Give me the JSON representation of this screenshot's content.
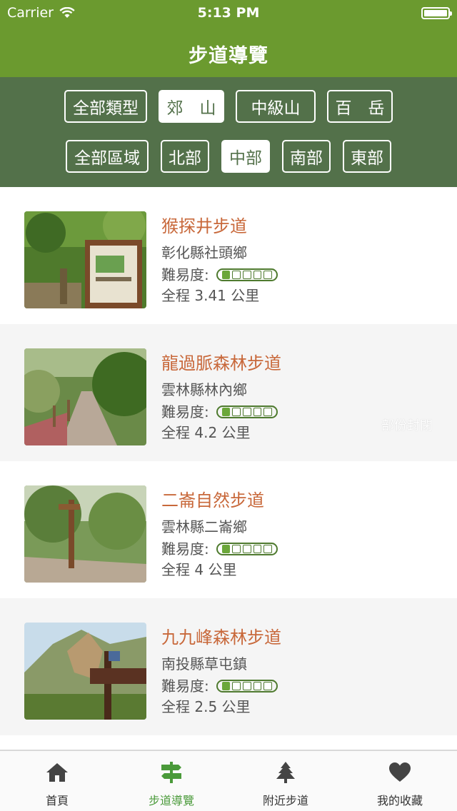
{
  "status_bar": {
    "carrier": "Carrier",
    "time": "5:13 PM"
  },
  "header": {
    "title": "步道導覽"
  },
  "filters": {
    "types": [
      {
        "label": "全部類型",
        "active": false
      },
      {
        "label": "郊　山",
        "active": true
      },
      {
        "label": "中級山",
        "active": false
      },
      {
        "label": "百　岳",
        "active": false
      }
    ],
    "regions": [
      {
        "label": "全部區域",
        "active": false
      },
      {
        "label": "北部",
        "active": false
      },
      {
        "label": "中部",
        "active": true
      },
      {
        "label": "南部",
        "active": false
      },
      {
        "label": "東部",
        "active": false
      }
    ]
  },
  "trails": [
    {
      "name": "猴探井步道",
      "location": "彰化縣社頭鄉",
      "difficulty_label": "難易度:",
      "difficulty": 1,
      "difficulty_max": 5,
      "distance": "全程 3.41 公里"
    },
    {
      "name": "龍過脈森林步道",
      "location": "雲林縣林內鄉",
      "difficulty_label": "難易度:",
      "difficulty": 1,
      "difficulty_max": 5,
      "distance": "全程 4.2 公里",
      "badge": "部份封閉"
    },
    {
      "name": "二崙自然步道",
      "location": "雲林縣二崙鄉",
      "difficulty_label": "難易度:",
      "difficulty": 1,
      "difficulty_max": 5,
      "distance": "全程 4 公里"
    },
    {
      "name": "九九峰森林步道",
      "location": "南投縣草屯鎮",
      "difficulty_label": "難易度:",
      "difficulty": 1,
      "difficulty_max": 5,
      "distance": "全程 2.5 公里"
    }
  ],
  "tabbar": {
    "tabs": [
      {
        "label": "首頁",
        "icon": "home-icon",
        "active": false
      },
      {
        "label": "步道導覽",
        "icon": "signpost-icon",
        "active": true
      },
      {
        "label": "附近步道",
        "icon": "tree-icon",
        "active": false
      },
      {
        "label": "我的收藏",
        "icon": "heart-icon",
        "active": false
      }
    ]
  },
  "colors": {
    "header": "#6b9a2f",
    "filters": "#53714a",
    "trail_name": "#c8683a",
    "active_tab": "#4a9a3a"
  }
}
